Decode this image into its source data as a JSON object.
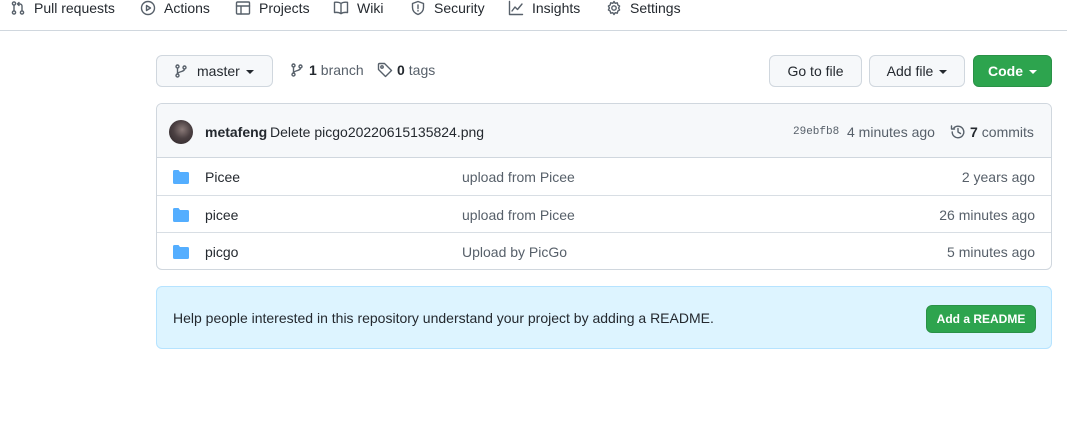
{
  "tabs": [
    {
      "label": "Pull requests",
      "icon": "pull-request-icon"
    },
    {
      "label": "Actions",
      "icon": "play-circle-icon"
    },
    {
      "label": "Projects",
      "icon": "table-icon"
    },
    {
      "label": "Wiki",
      "icon": "book-icon"
    },
    {
      "label": "Security",
      "icon": "shield-icon"
    },
    {
      "label": "Insights",
      "icon": "graph-icon"
    },
    {
      "label": "Settings",
      "icon": "gear-icon"
    }
  ],
  "toolbar": {
    "branch_name": "master",
    "branch_count": "1",
    "branch_label": "branch",
    "tag_count": "0",
    "tag_label": "tags",
    "goto_file": "Go to file",
    "add_file": "Add file",
    "code": "Code"
  },
  "latest_commit": {
    "author": "metafeng",
    "message": "Delete picgo20220615135824.png",
    "sha": "29ebfb8",
    "time": "4 minutes ago",
    "commit_count": "7",
    "commit_label": "commits"
  },
  "files": [
    {
      "name": "Picee",
      "type": "folder",
      "commit": "upload from Picee",
      "time": "2 years ago"
    },
    {
      "name": "picee",
      "type": "folder",
      "commit": "upload from Picee",
      "time": "26 minutes ago"
    },
    {
      "name": "picgo",
      "type": "folder",
      "commit": "Upload by PicGo",
      "time": "5 minutes ago"
    }
  ],
  "readme": {
    "message": "Help people interested in this repository understand your project by adding a README.",
    "button": "Add a README"
  },
  "colors": {
    "primary_green": "#2da44e",
    "folder_blue": "#54aeff",
    "readme_bg": "#ddf4ff"
  }
}
